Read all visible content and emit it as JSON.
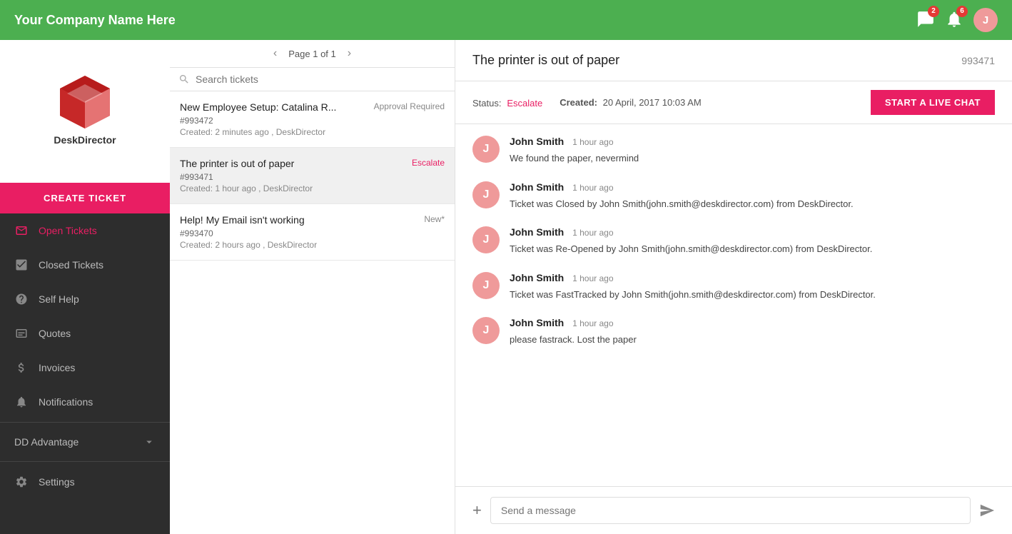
{
  "header": {
    "company_name": "Your Company Name Here",
    "icons": {
      "chat_badge": "2",
      "bell_badge": "6",
      "avatar_label": "J"
    }
  },
  "sidebar": {
    "logo_alt": "DeskDirector Logo",
    "create_ticket_label": "CREATE TICKET",
    "nav_items": [
      {
        "id": "open-tickets",
        "label": "Open Tickets",
        "active": true
      },
      {
        "id": "closed-tickets",
        "label": "Closed Tickets",
        "active": false
      },
      {
        "id": "self-help",
        "label": "Self Help",
        "active": false
      },
      {
        "id": "quotes",
        "label": "Quotes",
        "active": false
      },
      {
        "id": "invoices",
        "label": "Invoices",
        "active": false
      },
      {
        "id": "notifications",
        "label": "Notifications",
        "active": false
      }
    ],
    "dd_advantage_label": "DD Advantage",
    "settings_label": "Settings"
  },
  "ticket_list": {
    "pagination": {
      "label": "Page 1 of 1",
      "prev": "‹",
      "next": "›"
    },
    "search_placeholder": "Search tickets",
    "tickets": [
      {
        "title": "New Employee Setup: Catalina R...",
        "badge": "Approval Required",
        "badge_type": "approval",
        "number": "#993472",
        "meta": "Created: 2 minutes ago , DeskDirector",
        "selected": false
      },
      {
        "title": "The printer is out of paper",
        "badge": "Escalate",
        "badge_type": "escalate",
        "number": "#993471",
        "meta": "Created: 1 hour ago , DeskDirector",
        "selected": true
      },
      {
        "title": "Help! My Email isn't working",
        "badge": "New*",
        "badge_type": "new",
        "number": "#993470",
        "meta": "Created: 2 hours ago , DeskDirector",
        "selected": false
      }
    ]
  },
  "ticket_detail": {
    "title": "The printer is out of paper",
    "ticket_number": "993471",
    "status_label": "Status:",
    "status_value": "Escalate",
    "created_label": "Created:",
    "created_value": "20 April, 2017 10:03 AM",
    "live_chat_label": "START A LIVE CHAT",
    "messages": [
      {
        "avatar": "J",
        "author": "John Smith",
        "time": "1 hour ago",
        "text": "We found the paper, nevermind"
      },
      {
        "avatar": "J",
        "author": "John Smith",
        "time": "1 hour ago",
        "text": "Ticket was Closed by John Smith(john.smith@deskdirector.com) from DeskDirector."
      },
      {
        "avatar": "J",
        "author": "John Smith",
        "time": "1 hour ago",
        "text": "Ticket was Re-Opened by John Smith(john.smith@deskdirector.com) from DeskDirector."
      },
      {
        "avatar": "J",
        "author": "John Smith",
        "time": "1 hour ago",
        "text": "Ticket was FastTracked by John Smith(john.smith@deskdirector.com) from DeskDirector."
      },
      {
        "avatar": "J",
        "author": "John Smith",
        "time": "1 hour ago",
        "text": "please fastrack. Lost the paper"
      }
    ],
    "compose_placeholder": "Send a message"
  },
  "colors": {
    "accent": "#e91e63",
    "sidebar_bg": "#2d2d2d",
    "header_bg": "#4caf50"
  }
}
